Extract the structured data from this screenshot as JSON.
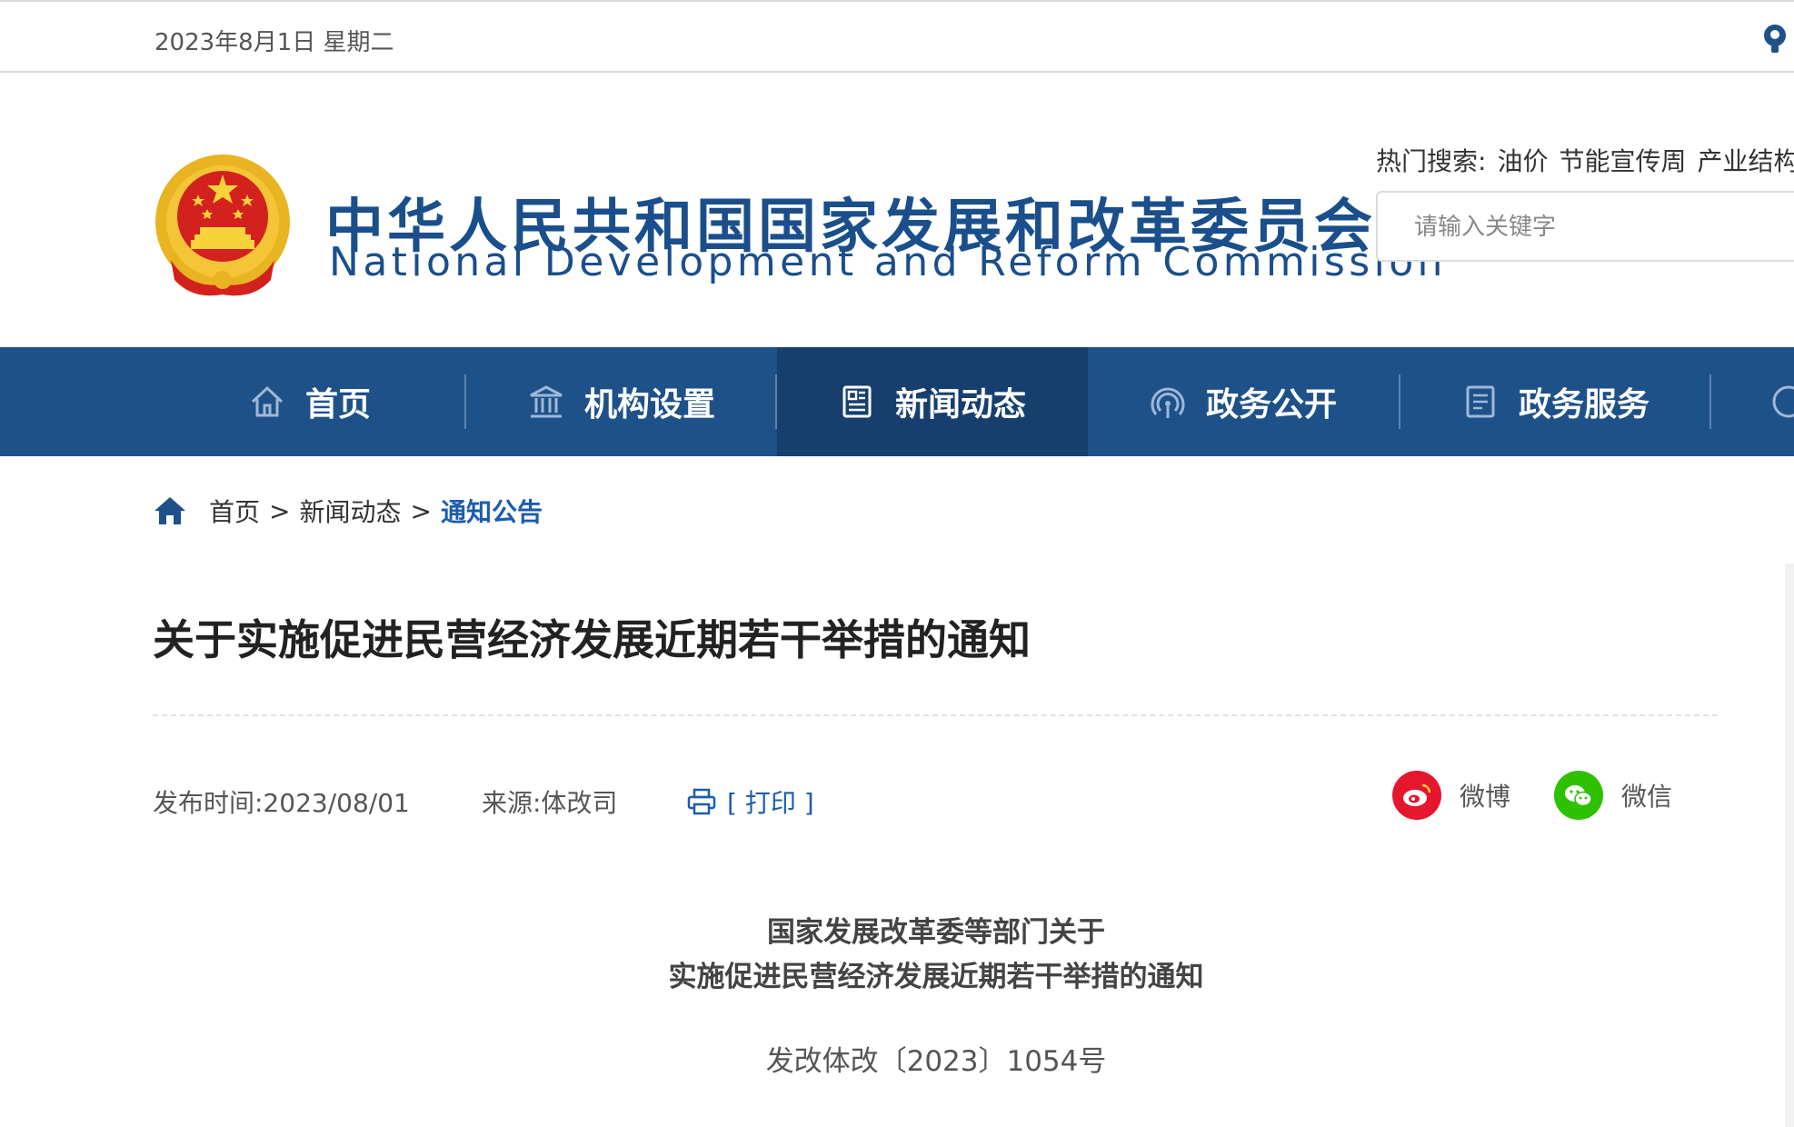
{
  "topbar": {
    "date": "2023年8月1日 星期二"
  },
  "header": {
    "site_title_cn": "中华人民共和国国家发展和改革委员会",
    "site_title_en": "National Development and Reform Commission",
    "hot_search_label": "热门搜索:",
    "hot_search_items": [
      "油价",
      "节能宣传周",
      "产业结构"
    ],
    "search_placeholder": "请输入关键字"
  },
  "nav": {
    "items": [
      {
        "label": "首页",
        "icon": "home-icon"
      },
      {
        "label": "机构设置",
        "icon": "institution-icon"
      },
      {
        "label": "新闻动态",
        "icon": "news-icon",
        "active": true
      },
      {
        "label": "政务公开",
        "icon": "broadcast-icon"
      },
      {
        "label": "政务服务",
        "icon": "document-icon"
      }
    ]
  },
  "breadcrumb": {
    "items": [
      "首页",
      "新闻动态",
      "通知公告"
    ],
    "separator": ">"
  },
  "article": {
    "title": "关于实施促进民营经济发展近期若干举措的通知",
    "publish_time": "发布时间:2023/08/01",
    "source": "来源:体改司",
    "print_label": "[ 打印 ]",
    "share": {
      "weibo": "微博",
      "wechat": "微信"
    },
    "body_heading_line1": "国家发展改革委等部门关于",
    "body_heading_line2": "实施促进民营经济发展近期若干举措的通知",
    "document_number": "发改体改〔2023〕1054号"
  },
  "colors": {
    "brand_blue": "#1a4f8c",
    "nav_bg": "#1f5189",
    "nav_active_bg": "#173f6e",
    "link_blue": "#1a5cad",
    "weibo_red": "#e6162d",
    "wechat_green": "#2dc100"
  }
}
